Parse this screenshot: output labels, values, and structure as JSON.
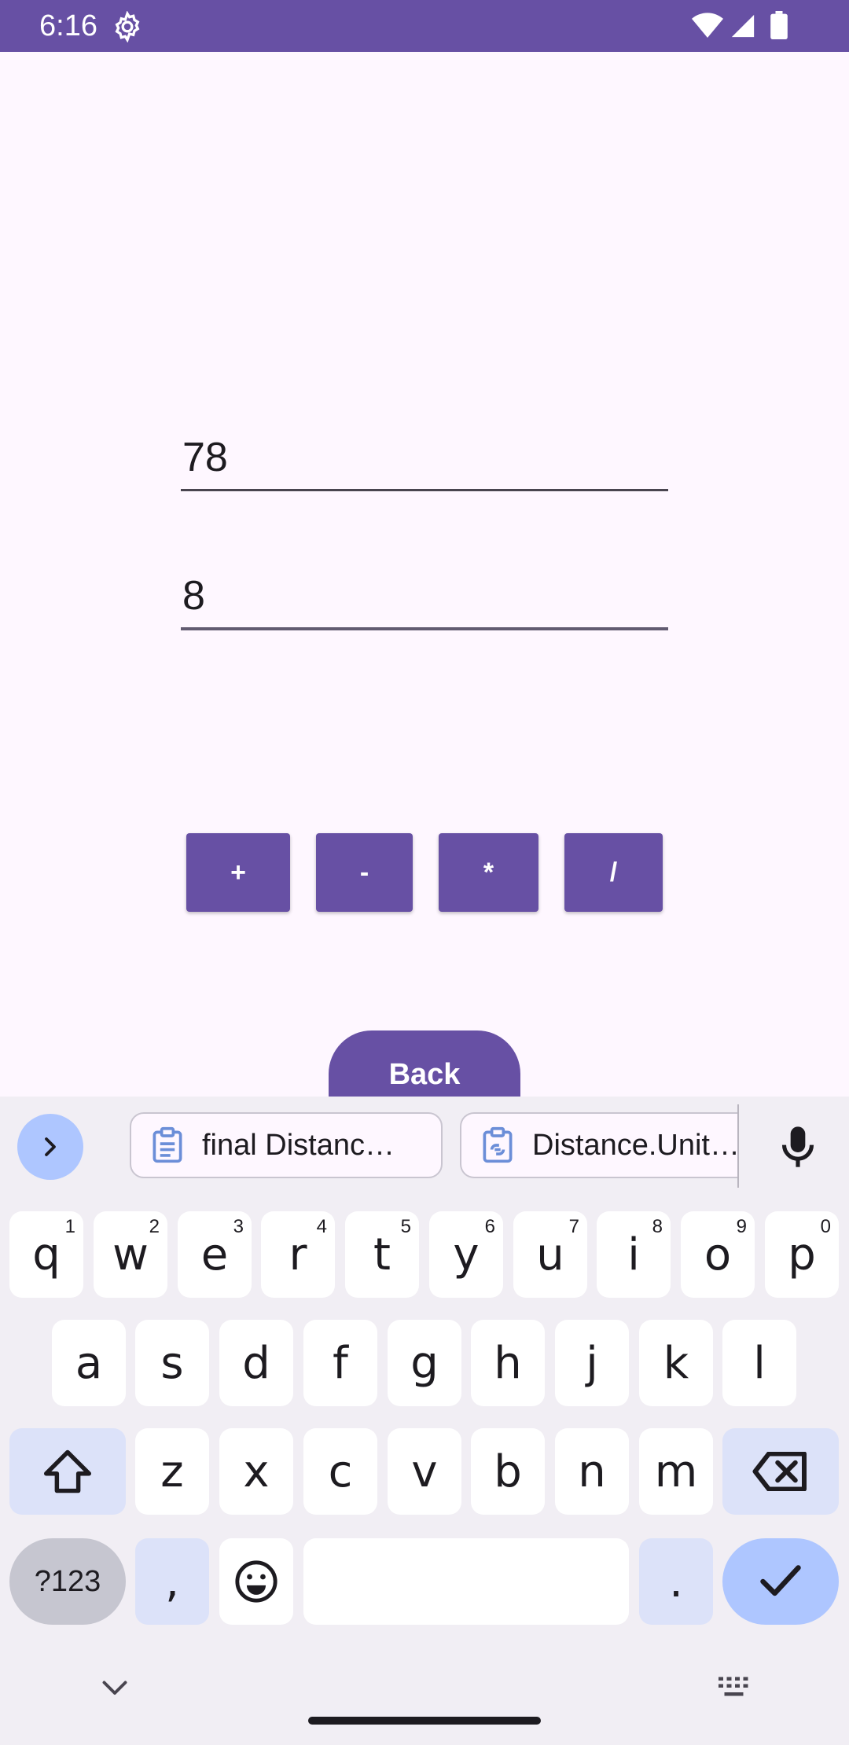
{
  "status": {
    "time": "6:16"
  },
  "inputs": {
    "first": "78",
    "second": "8"
  },
  "operators": {
    "add": "+",
    "subtract": "-",
    "multiply": "*",
    "divide": "/"
  },
  "back_label": "Back",
  "suggestions": {
    "chip1": "final Distanc…",
    "chip2": "Distance.Unit…"
  },
  "keyboard": {
    "row1": [
      "q",
      "w",
      "e",
      "r",
      "t",
      "y",
      "u",
      "i",
      "o",
      "p"
    ],
    "row1_nums": [
      "1",
      "2",
      "3",
      "4",
      "5",
      "6",
      "7",
      "8",
      "9",
      "0"
    ],
    "row2": [
      "a",
      "s",
      "d",
      "f",
      "g",
      "h",
      "j",
      "k",
      "l"
    ],
    "row3": [
      "z",
      "x",
      "c",
      "v",
      "b",
      "n",
      "m"
    ],
    "symbols_label": "?123",
    "comma": ",",
    "period": "."
  },
  "colors": {
    "primary": "#6750a4",
    "background": "#fef7ff",
    "keyboard": "#f1eef4",
    "accent": "#aec6ff"
  }
}
